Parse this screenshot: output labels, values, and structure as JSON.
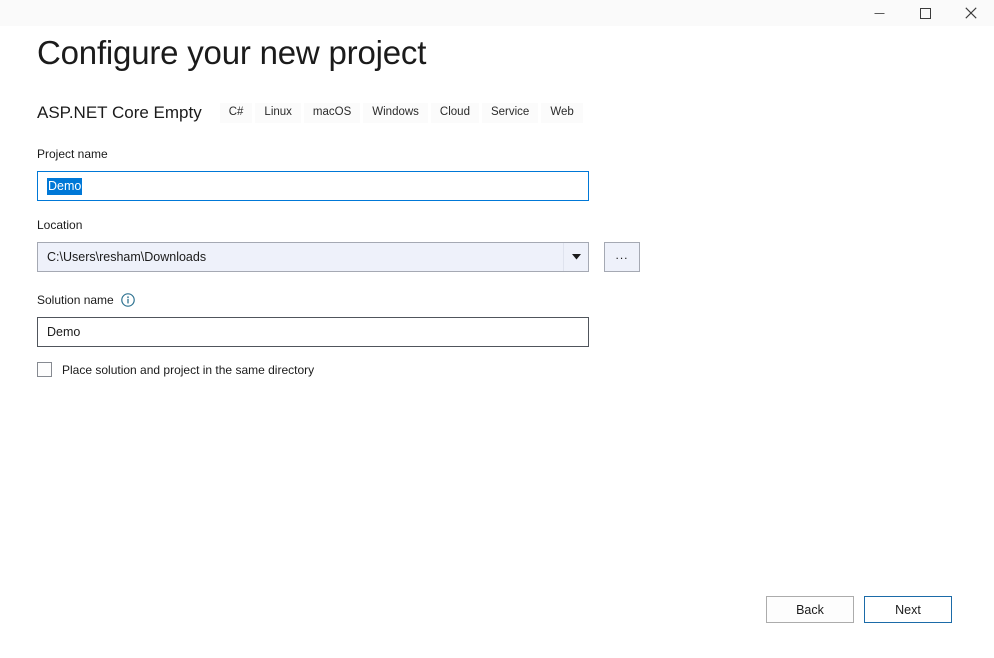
{
  "window": {
    "controls": [
      {
        "name": "minimize-button",
        "icon": "minimize-icon",
        "label": "Minimize"
      },
      {
        "name": "maximize-button",
        "icon": "maximize-icon",
        "label": "Maximize"
      },
      {
        "name": "close-button",
        "icon": "close-icon",
        "label": "Close"
      }
    ]
  },
  "header": {
    "title": "Configure your new project",
    "template_name": "ASP.NET Core Empty",
    "tags": [
      "C#",
      "Linux",
      "macOS",
      "Windows",
      "Cloud",
      "Service",
      "Web"
    ]
  },
  "form": {
    "project_name": {
      "label": "Project name",
      "value": "Demo",
      "placeholder": "",
      "selected": true
    },
    "location": {
      "label": "Location",
      "value": "C:\\Users\\resham\\Downloads",
      "placeholder": "",
      "browse_label": "..."
    },
    "solution_name": {
      "label": "Solution name",
      "value": "Demo",
      "placeholder": "",
      "info_icon": "info-icon"
    },
    "same_directory": {
      "label": "Place solution and project in the same directory",
      "checked": false
    }
  },
  "footer": {
    "back_label": "Back",
    "next_label": "Next"
  },
  "colors": {
    "accent": "#0078d7",
    "primary_button_border": "#1b6ba8",
    "info_icon": "#2f7391",
    "selection": "#0078d7",
    "background": "#ffffff",
    "titlebar": "#fafafa"
  }
}
